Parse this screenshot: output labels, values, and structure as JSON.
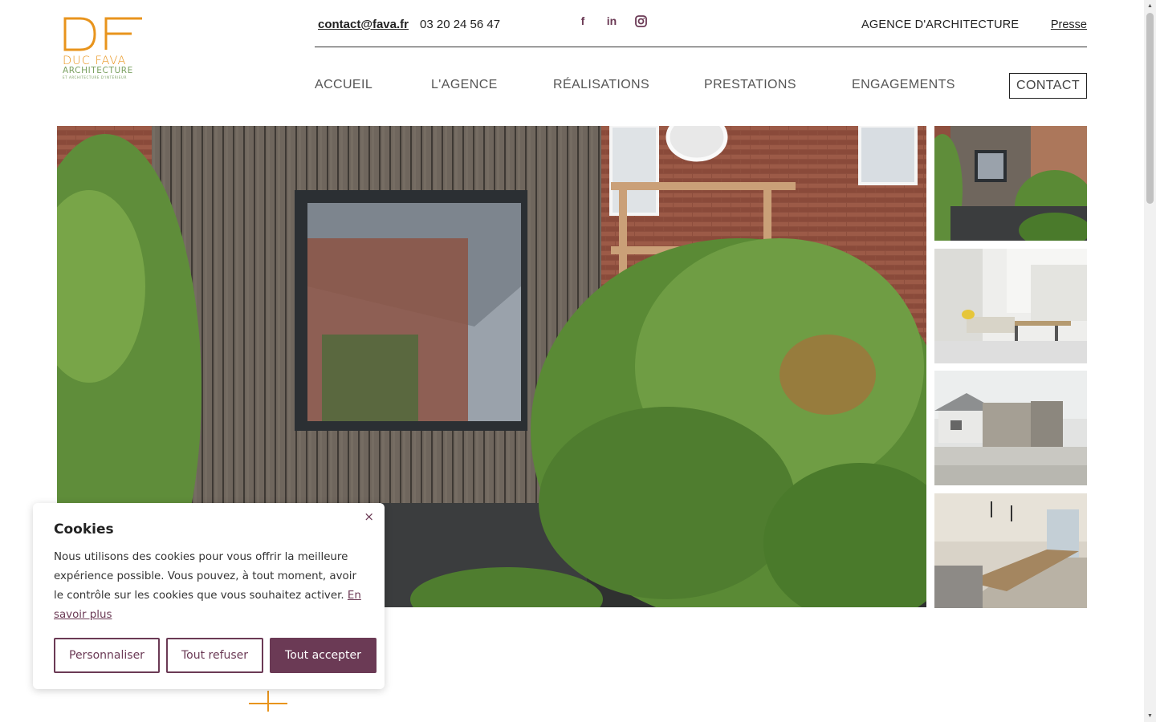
{
  "brand": {
    "logo_name": "DUC FAVA",
    "logo_line2": "ARCHITECTURE",
    "logo_line3": "ET ARCHITECTURE D'INTÉRIEUR",
    "accent_orange": "#e8941d",
    "accent_green": "#7aa060",
    "accent_plum": "#6b3a55"
  },
  "topbar": {
    "email": "contact@fava.fr",
    "phone": "03 20 24 56 47",
    "social": [
      {
        "icon": "facebook-icon",
        "glyph": "f"
      },
      {
        "icon": "linkedin-icon",
        "glyph": "in"
      },
      {
        "icon": "instagram-icon",
        "glyph": ""
      }
    ],
    "agence_label": "AGENCE D'ARCHITECTURE",
    "presse_label": "Presse"
  },
  "nav": {
    "items": [
      "ACCUEIL",
      "L'AGENCE",
      "RÉALISATIONS",
      "PRESTATIONS",
      "ENGAGEMENTS"
    ],
    "contact_label": "CONTACT"
  },
  "cookie": {
    "title": "Cookies",
    "text": "Nous utilisons des cookies pour vous offrir la meilleure expérience possible. Vous pouvez, à tout moment, avoir le contrôle sur les cookies que vous souhaitez activer.",
    "link_label": "En savoir plus",
    "close_glyph": "×",
    "buttons": {
      "customize": "Personnaliser",
      "refuse": "Tout refuser",
      "accept": "Tout accepter"
    }
  },
  "scrollbar": {
    "up_glyph": "▲",
    "down_glyph": "▼"
  }
}
